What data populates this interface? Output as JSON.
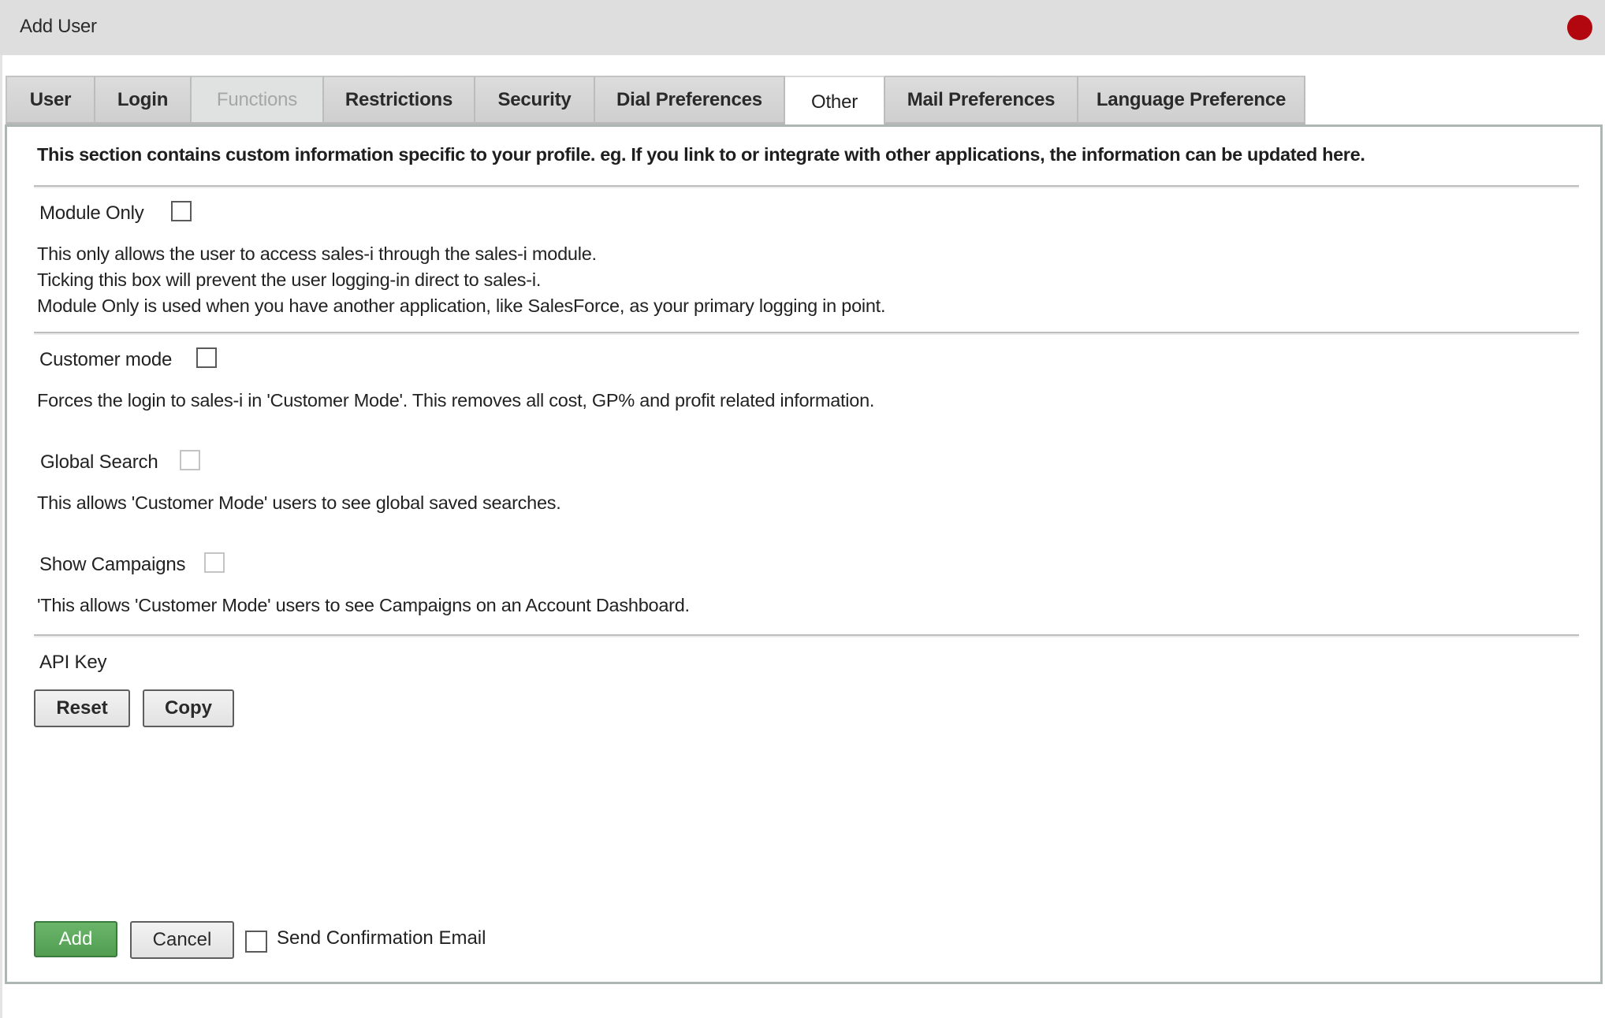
{
  "window": {
    "title": "Add User",
    "close_icon": "red-circle-close-icon",
    "close_color": "#b30710"
  },
  "tabs": [
    {
      "label": "User",
      "state": "normal"
    },
    {
      "label": "Login",
      "state": "normal"
    },
    {
      "label": "Functions",
      "state": "disabled"
    },
    {
      "label": "Restrictions",
      "state": "normal"
    },
    {
      "label": "Security",
      "state": "normal"
    },
    {
      "label": "Dial Preferences",
      "state": "normal"
    },
    {
      "label": "Other",
      "state": "active"
    },
    {
      "label": "Mail Preferences",
      "state": "normal"
    },
    {
      "label": "Language Preference",
      "state": "normal"
    }
  ],
  "other": {
    "intro": "This section contains custom information specific to your profile. eg. If you link to or integrate with other applications, the information can be updated here.",
    "module_only": {
      "label": "Module Only",
      "checked": false,
      "enabled": true,
      "description": [
        "This only allows the user to access sales-i through the sales-i module.",
        "Ticking this box will prevent the user logging-in direct to sales-i.",
        "Module Only is used when you have another application, like SalesForce, as your primary logging in point."
      ]
    },
    "customer_mode": {
      "label": "Customer mode",
      "checked": false,
      "enabled": true,
      "description": "Forces the login to sales-i in 'Customer Mode'. This removes all cost, GP% and profit related information."
    },
    "global_search": {
      "label": "Global Search",
      "checked": false,
      "enabled": false,
      "description": "This allows 'Customer Mode' users to see global saved searches."
    },
    "show_campaigns": {
      "label": "Show Campaigns",
      "checked": false,
      "enabled": false,
      "description": "'This allows 'Customer Mode' users to see Campaigns on an Account Dashboard."
    },
    "api_key": {
      "label": "API Key",
      "reset_label": "Reset",
      "copy_label": "Copy"
    }
  },
  "footer": {
    "add_label": "Add",
    "cancel_label": "Cancel",
    "send_confirmation_label": "Send Confirmation Email",
    "send_confirmation_checked": false,
    "add_color": "#5aa55a"
  }
}
